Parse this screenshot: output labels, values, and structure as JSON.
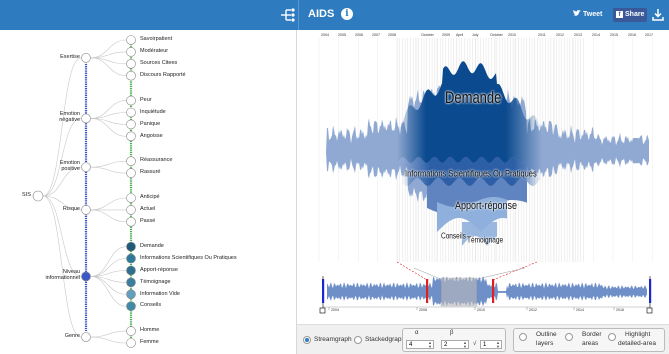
{
  "header": {
    "title": "AIDS",
    "info_glyph": "i",
    "tweet_label": "Tweet",
    "share_label": "Share",
    "bg_color": "#2f7bbf"
  },
  "tree": {
    "root_label": "SIS",
    "groups": [
      {
        "label": "Exertise",
        "children": [
          "Savoirpatient",
          "Modérateur",
          "Sources Citees",
          "Discours Rapporté"
        ]
      },
      {
        "label": "Emotion\nnégative",
        "children": [
          "Peur",
          "Inquiétude",
          "Panique",
          "Angoisse"
        ]
      },
      {
        "label": "Emotion\npositive",
        "children": [
          "Réassurance",
          "Rassuré"
        ]
      },
      {
        "label": "Risque",
        "children": [
          "Anticipé",
          "Actuel",
          "Passé"
        ]
      },
      {
        "label": "Niveau\ninformationnel",
        "children": [
          "Demande",
          "Informations Scientifiques Ou Pratiques",
          "Apport-réponse",
          "Témoignage",
          "Information Vide",
          "Conseils"
        ]
      },
      {
        "label": "Genre",
        "children": [
          "Homme",
          "Femme"
        ]
      }
    ]
  },
  "stream": {
    "top_axis_labels": [
      "2004",
      "2005",
      "2006",
      "2007",
      "2008",
      "October",
      "2009",
      "April",
      "July",
      "October",
      "2010",
      "2011",
      "2012",
      "2013",
      "2014",
      "2015",
      "2016",
      "2017"
    ],
    "layer_labels": [
      "Demande",
      "Informations Scientifiques Ou Pratiques",
      "Apport-réponse",
      "Conseils",
      "Témoignage"
    ],
    "layer_colors": [
      "#8aa4d0",
      "#2c5fa6",
      "#0b4a8e",
      "#5f84c0",
      "#8fb0dc"
    ]
  },
  "overview": {
    "axis_labels": [
      "2004",
      "2008",
      "2010",
      "2012",
      "2014",
      "2016"
    ]
  },
  "controls": {
    "streamgraph_label": "Streamgraph",
    "stackedgraph_label": "Stackedgraph",
    "alpha_symbol": "α",
    "beta_symbol": "β",
    "alpha_value": "4",
    "beta_value": "2",
    "root_symbol": "√",
    "root_value": "1",
    "outline_label_1": "Outline",
    "outline_label_2": "layers",
    "border_label_1": "Border",
    "border_label_2": "areas",
    "highlight_label_1": "Highlight",
    "highlight_label_2": "detailed-area"
  }
}
